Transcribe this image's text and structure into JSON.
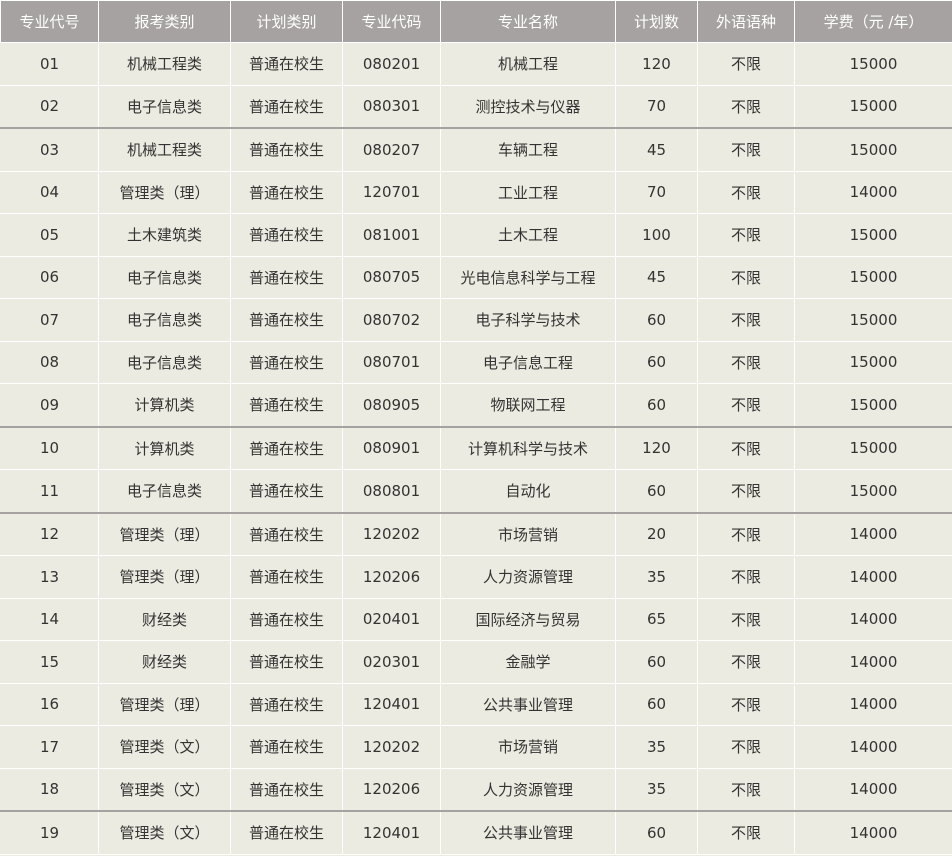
{
  "table": {
    "headers": [
      "专业代号",
      "报考类别",
      "计划类别",
      "专业代码",
      "专业名称",
      "计划数",
      "外语语种",
      "学费（元  /年）"
    ],
    "rows": [
      {
        "no": "01",
        "category": "机械工程类",
        "plan_type": "普通在校生",
        "code": "080201",
        "name": "机械工程",
        "count": "120",
        "language": "不限",
        "fee": "15000"
      },
      {
        "no": "02",
        "category": "电子信息类",
        "plan_type": "普通在校生",
        "code": "080301",
        "name": "测控技术与仪器",
        "count": "70",
        "language": "不限",
        "fee": "15000"
      },
      {
        "no": "03",
        "category": "机械工程类",
        "plan_type": "普通在校生",
        "code": "080207",
        "name": "车辆工程",
        "count": "45",
        "language": "不限",
        "fee": "15000"
      },
      {
        "no": "04",
        "category": "管理类（理）",
        "plan_type": "普通在校生",
        "code": "120701",
        "name": "工业工程",
        "count": "70",
        "language": "不限",
        "fee": "14000"
      },
      {
        "no": "05",
        "category": "土木建筑类",
        "plan_type": "普通在校生",
        "code": "081001",
        "name": "土木工程",
        "count": "100",
        "language": "不限",
        "fee": "15000"
      },
      {
        "no": "06",
        "category": "电子信息类",
        "plan_type": "普通在校生",
        "code": "080705",
        "name": "光电信息科学与工程",
        "count": "45",
        "language": "不限",
        "fee": "15000"
      },
      {
        "no": "07",
        "category": "电子信息类",
        "plan_type": "普通在校生",
        "code": "080702",
        "name": "电子科学与技术",
        "count": "60",
        "language": "不限",
        "fee": "15000"
      },
      {
        "no": "08",
        "category": "电子信息类",
        "plan_type": "普通在校生",
        "code": "080701",
        "name": "电子信息工程",
        "count": "60",
        "language": "不限",
        "fee": "15000"
      },
      {
        "no": "09",
        "category": "计算机类",
        "plan_type": "普通在校生",
        "code": "080905",
        "name": "物联网工程",
        "count": "60",
        "language": "不限",
        "fee": "15000"
      },
      {
        "no": "10",
        "category": "计算机类",
        "plan_type": "普通在校生",
        "code": "080901",
        "name": "计算机科学与技术",
        "count": "120",
        "language": "不限",
        "fee": "15000"
      },
      {
        "no": "11",
        "category": "电子信息类",
        "plan_type": "普通在校生",
        "code": "080801",
        "name": "自动化",
        "count": "60",
        "language": "不限",
        "fee": "15000"
      },
      {
        "no": "12",
        "category": "管理类（理）",
        "plan_type": "普通在校生",
        "code": "120202",
        "name": "市场营销",
        "count": "20",
        "language": "不限",
        "fee": "14000"
      },
      {
        "no": "13",
        "category": "管理类（理）",
        "plan_type": "普通在校生",
        "code": "120206",
        "name": "人力资源管理",
        "count": "35",
        "language": "不限",
        "fee": "14000"
      },
      {
        "no": "14",
        "category": "财经类",
        "plan_type": "普通在校生",
        "code": "020401",
        "name": "国际经济与贸易",
        "count": "65",
        "language": "不限",
        "fee": "14000"
      },
      {
        "no": "15",
        "category": "财经类",
        "plan_type": "普通在校生",
        "code": "020301",
        "name": "金融学",
        "count": "60",
        "language": "不限",
        "fee": "14000"
      },
      {
        "no": "16",
        "category": "管理类（理）",
        "plan_type": "普通在校生",
        "code": "120401",
        "name": "公共事业管理",
        "count": "60",
        "language": "不限",
        "fee": "14000"
      },
      {
        "no": "17",
        "category": "管理类（文）",
        "plan_type": "普通在校生",
        "code": "120202",
        "name": "市场营销",
        "count": "35",
        "language": "不限",
        "fee": "14000"
      },
      {
        "no": "18",
        "category": "管理类（文）",
        "plan_type": "普通在校生",
        "code": "120206",
        "name": "人力资源管理",
        "count": "35",
        "language": "不限",
        "fee": "14000"
      },
      {
        "no": "19",
        "category": "管理类（文）",
        "plan_type": "普通在校生",
        "code": "120401",
        "name": "公共事业管理",
        "count": "60",
        "language": "不限",
        "fee": "14000"
      }
    ]
  },
  "colors": {
    "header_bg": "#a7a2a2",
    "header_text": "#ffffff",
    "cell_bg": "#ecebe1",
    "cell_text": "#333333",
    "grid": "#ffffff"
  }
}
